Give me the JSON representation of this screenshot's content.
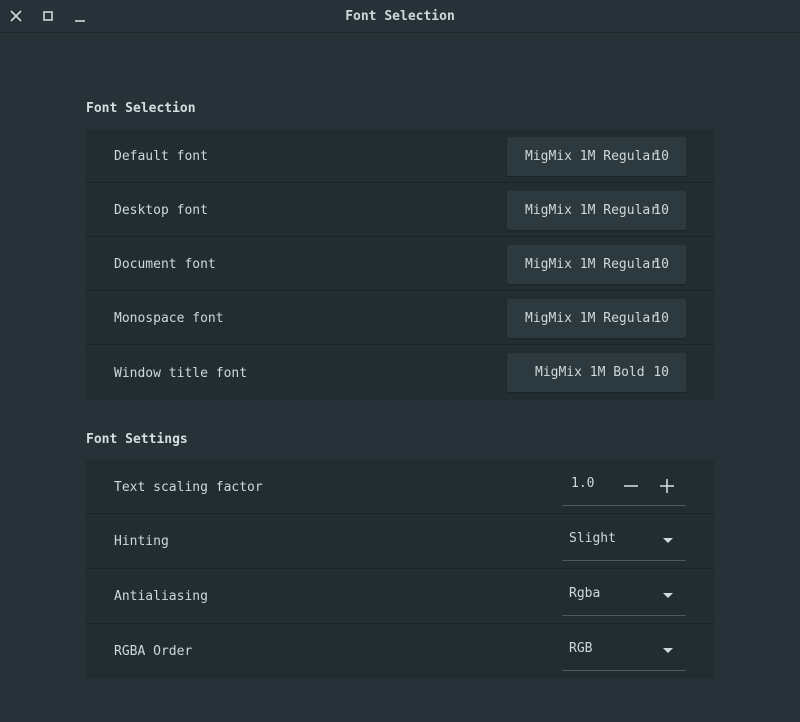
{
  "window": {
    "title": "Font Selection"
  },
  "sections": {
    "font_selection": {
      "title": "Font Selection",
      "rows": [
        {
          "label": "Default font",
          "font_name": "MigMix 1M Regular",
          "font_size": "10"
        },
        {
          "label": "Desktop font",
          "font_name": "MigMix 1M Regular",
          "font_size": "10"
        },
        {
          "label": "Document font",
          "font_name": "MigMix 1M Regular",
          "font_size": "10"
        },
        {
          "label": "Monospace font",
          "font_name": "MigMix 1M Regular",
          "font_size": "10"
        },
        {
          "label": "Window title font",
          "font_name": "MigMix 1M Bold",
          "font_size": "10"
        }
      ]
    },
    "font_settings": {
      "title": "Font Settings",
      "text_scaling": {
        "label": "Text scaling factor",
        "value": "1.0"
      },
      "hinting": {
        "label": "Hinting",
        "value": "Slight"
      },
      "antialiasing": {
        "label": "Antialiasing",
        "value": "Rgba"
      },
      "rgba_order": {
        "label": "RGBA Order",
        "value": "RGB"
      }
    }
  },
  "colors": {
    "background": "#263238",
    "panel": "#222d32",
    "button": "#2c393f",
    "text": "#cfd8dc"
  },
  "icons": {
    "close": "close-icon",
    "maximize": "maximize-icon",
    "minimize": "minimize-icon",
    "minus": "minus-icon",
    "plus": "plus-icon",
    "dropdown": "dropdown-arrow-icon"
  }
}
